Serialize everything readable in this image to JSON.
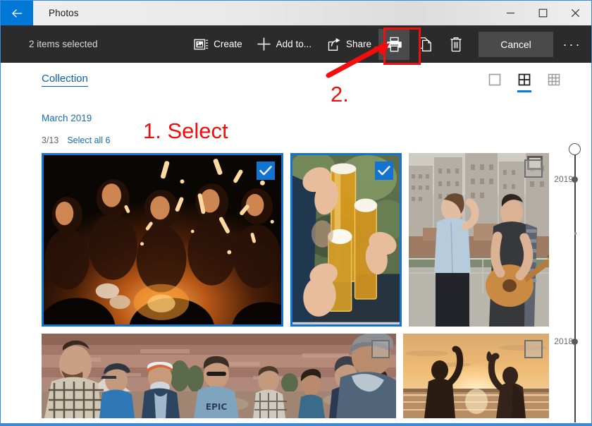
{
  "window": {
    "title": "Photos",
    "back_icon": "back-arrow-icon",
    "controls": [
      {
        "name": "minimize",
        "icon": "minimize-icon",
        "label": "–"
      },
      {
        "name": "maximize",
        "icon": "maximize-icon",
        "label": "□"
      },
      {
        "name": "close",
        "icon": "close-icon",
        "label": "✕"
      }
    ]
  },
  "commandbar": {
    "selection_text": "2 items selected",
    "background_color": "#2b2b2b",
    "items": [
      {
        "name": "create",
        "label": "Create",
        "icon": "create-video-icon",
        "type": "icon-label"
      },
      {
        "name": "add-to",
        "label": "Add to...",
        "icon": "plus-icon",
        "type": "icon-label"
      },
      {
        "name": "share",
        "label": "Share",
        "icon": "share-icon",
        "type": "icon-label"
      },
      {
        "name": "print",
        "label": "Print",
        "icon": "printer-icon",
        "type": "icon-only",
        "highlighted": true
      },
      {
        "name": "copy",
        "label": "Copy",
        "icon": "copy-icon",
        "type": "icon-only",
        "highlighted": false
      },
      {
        "name": "delete",
        "label": "Delete",
        "icon": "trash-icon",
        "type": "icon-only",
        "highlighted": false
      }
    ],
    "cancel_label": "Cancel",
    "more_label": "···",
    "more_icon": "ellipsis-icon"
  },
  "content": {
    "tab_label": "Collection",
    "view_modes": [
      {
        "name": "single",
        "icon": "single-square-icon",
        "active": false
      },
      {
        "name": "medium-grid",
        "icon": "grid-2x2-icon",
        "active": true
      },
      {
        "name": "small-grid",
        "icon": "grid-3x3-icon",
        "active": false
      }
    ],
    "month_label": "March 2019",
    "selected_fraction": "3/13",
    "select_all_label": "Select all 6",
    "accent_color": "#0078d7",
    "selection_border_color": "#1273d3",
    "link_color": "#156bb5",
    "photos": [
      {
        "name": "photo-bonfire-group",
        "alt": "Group of people around a bonfire at night with sparklers",
        "selected": true,
        "checkbox": "checked"
      },
      {
        "name": "photo-beer-toast",
        "alt": "Hands toasting tall glasses of beer with foam",
        "selected": true,
        "checkbox": "checked"
      },
      {
        "name": "photo-rooftop-guitar",
        "alt": "Woman laughing and man playing guitar on a city rooftop",
        "selected": false,
        "checkbox": "unchecked"
      },
      {
        "name": "photo-desert-friends",
        "alt": "Group of friends sitting together in a desert canyon",
        "selected": false,
        "checkbox": "unchecked"
      },
      {
        "name": "photo-beach-sunset-highfive",
        "alt": "Two silhouettes high-fiving against a beach sunset",
        "selected": false,
        "checkbox": "unchecked"
      }
    ]
  },
  "timeline": {
    "name": "year-scrollbar",
    "thumb_icon": "scroll-thumb-circle",
    "marks": [
      {
        "label": "2019",
        "size": "large"
      },
      {
        "label": "",
        "size": "mini"
      },
      {
        "label": "2018",
        "size": "large"
      }
    ]
  },
  "annotations": [
    {
      "name": "annotation-step-1",
      "text": "1. Select",
      "color": "#f40d0d"
    },
    {
      "name": "annotation-step-2",
      "text": "2.",
      "color": "#f40d0d"
    },
    {
      "name": "annotation-print-highlight",
      "text": "",
      "color": "#ee1111"
    }
  ]
}
